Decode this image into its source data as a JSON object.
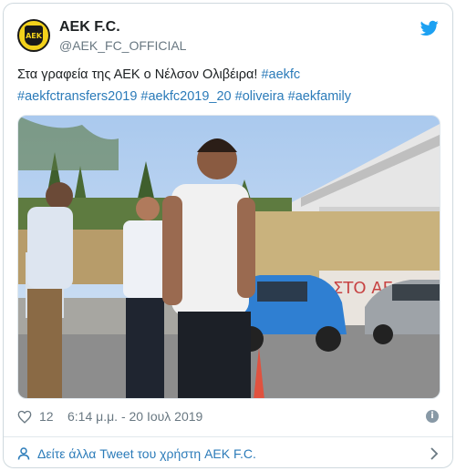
{
  "account": {
    "display_name": "AEK F.C.",
    "handle": "@AEK_FC_OFFICIAL",
    "avatar_text": "ΑΕΚ",
    "logo_icon": "aek-logo"
  },
  "tweet": {
    "text_plain": "Στα γραφεία της ΑΕΚ ο Νέλσον Ολιβέιρα! ",
    "hashtags": [
      "#aekfc",
      "#aekfctransfers2019",
      "#aekfc2019_20",
      "#oliveira",
      "#aekfamily"
    ]
  },
  "media": {
    "description_icon": "photo",
    "wall_text": "ΣΤΟ ΑΕ"
  },
  "meta": {
    "likes": "12",
    "timestamp": "6:14 μ.μ. - 20 Ιουλ 2019",
    "heart_icon": "heart-icon",
    "info_icon": "info-icon"
  },
  "footer": {
    "label": "Δείτε άλλα Tweet του χρήστη AEK F.C."
  },
  "colors": {
    "link": "#2b7bb9",
    "twitter_blue": "#1da1f2",
    "brand_yellow": "#f3d21b",
    "muted": "#697882"
  }
}
